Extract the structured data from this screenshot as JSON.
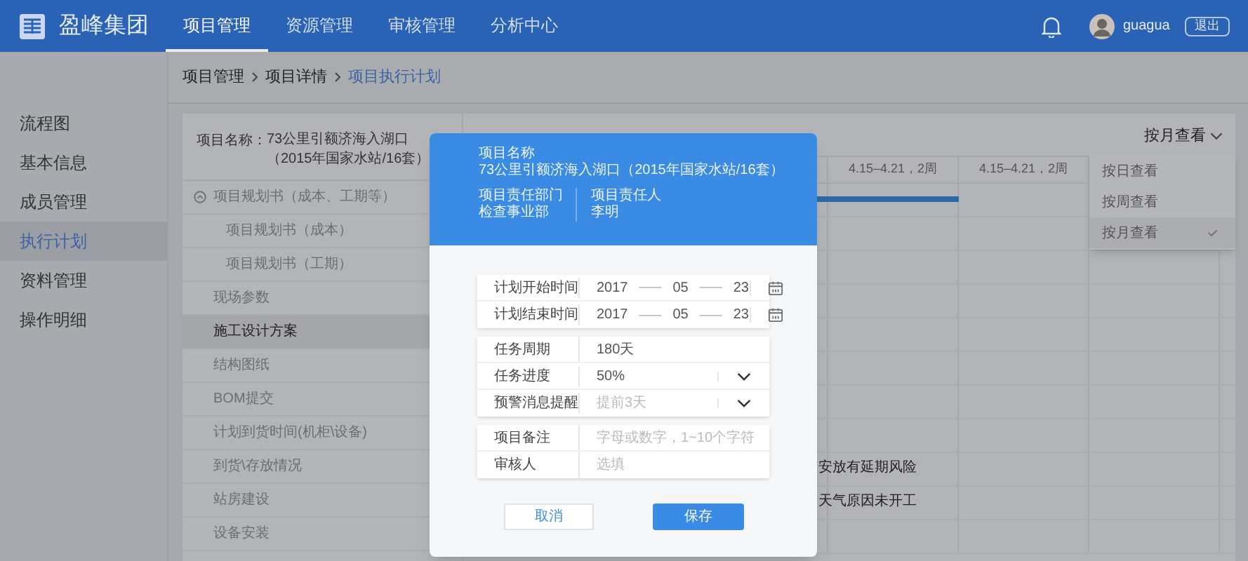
{
  "header": {
    "logo": "盈峰集团",
    "nav": [
      {
        "label": "项目管理",
        "selected": true
      },
      {
        "label": "资源管理",
        "selected": false
      },
      {
        "label": "审核管理",
        "selected": false
      },
      {
        "label": "分析中心",
        "selected": false
      }
    ],
    "user": "guagua",
    "logout": "退出"
  },
  "breadcrumb": [
    {
      "label": "项目管理",
      "current": false
    },
    {
      "label": "项目详情",
      "current": false
    },
    {
      "label": "项目执行计划",
      "current": true
    }
  ],
  "sidebar": {
    "items": [
      {
        "label": "流程图",
        "selected": false
      },
      {
        "label": "基本信息",
        "selected": false
      },
      {
        "label": "成员管理",
        "selected": false
      },
      {
        "label": "执行计划",
        "selected": true
      },
      {
        "label": "资料管理",
        "selected": false
      },
      {
        "label": "操作明细",
        "selected": false
      }
    ]
  },
  "project": {
    "label": "项目名称：",
    "name": "73公里引额济海入湖口（2015年国家水站/16套）"
  },
  "tree": [
    {
      "label": "项目规划书（成本、工期等）",
      "selected": false,
      "expanded": true,
      "children": [
        {
          "label": "项目规划书（成本）",
          "selected": false
        },
        {
          "label": "项目规划书（工期）",
          "selected": false
        }
      ]
    },
    {
      "label": "现场参数",
      "selected": false
    },
    {
      "label": "施工设计方案",
      "selected": true
    },
    {
      "label": "结构图纸",
      "selected": false
    },
    {
      "label": "BOM提交",
      "selected": false
    },
    {
      "label": "计划到货时间(机柜\\设备)",
      "selected": false
    },
    {
      "label": "到货\\存放情况",
      "selected": false
    },
    {
      "label": "站房建设",
      "selected": false
    },
    {
      "label": "设备安装",
      "selected": false
    }
  ],
  "gantt": {
    "columns": [
      "4.15–4.21，2周",
      "4.15–4.21，2周"
    ],
    "rows": [
      {
        "bar": true
      },
      {
        "bar": false
      },
      {
        "bar": false
      },
      {
        "bar": false
      },
      {
        "bar": false
      },
      {
        "bar": false
      },
      {
        "bar": false
      },
      {
        "bar": false
      },
      {
        "note": "安放有延期风险",
        "bar": false
      },
      {
        "note": "天气原因未开工",
        "bar": false
      },
      {
        "bar": false
      }
    ]
  },
  "view_menu": {
    "label": "按月查看",
    "items": [
      {
        "label": "按日查看",
        "selected": false
      },
      {
        "label": "按周查看",
        "selected": false
      },
      {
        "label": "按月查看",
        "selected": true
      }
    ]
  },
  "dialog": {
    "name_label": "项目名称",
    "name": "73公里引额济海入湖口（2015年国家水站/16套）",
    "dept_label": "项目责任部门",
    "dept": "检查事业部",
    "owner_label": "项目责任人",
    "owner": "李明",
    "groups": [
      [
        {
          "kind": "date",
          "label": "计划开始时间",
          "year": "2017",
          "month": "05",
          "day": "23",
          "sep": "——"
        },
        {
          "kind": "date",
          "label": "计划结束时间",
          "year": "2017",
          "month": "05",
          "day": "23",
          "sep": "——"
        }
      ],
      [
        {
          "kind": "text",
          "label": "任务周期",
          "value": "180天"
        },
        {
          "kind": "select",
          "label": "任务进度",
          "value": "50%"
        },
        {
          "kind": "select",
          "label": "预警消息提醒",
          "placeholder": "提前3天"
        }
      ],
      [
        {
          "kind": "text",
          "label": "项目备注",
          "placeholder": "字母或数字，1~10个字符"
        },
        {
          "kind": "text",
          "label": "审核人",
          "placeholder": "选填"
        }
      ]
    ],
    "cancel": "取消",
    "save": "保存"
  }
}
